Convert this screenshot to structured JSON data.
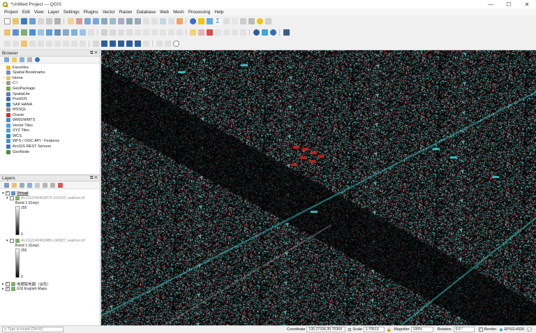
{
  "window": {
    "title": "*Untitled Project — QGIS",
    "minimize": "—",
    "maximize": "☐",
    "close": "✕"
  },
  "menu": [
    "Project",
    "Edit",
    "View",
    "Layer",
    "Settings",
    "Plugins",
    "Vector",
    "Raster",
    "Database",
    "Web",
    "Mesh",
    "Processing",
    "Help"
  ],
  "browser": {
    "title": "Browser",
    "items": [
      {
        "label": "Favorites",
        "icon": "star-icon",
        "color": "#e8b923",
        "twist": ""
      },
      {
        "label": "Spatial Bookmarks",
        "icon": "bookmark-icon",
        "color": "#6d8fb8",
        "twist": ""
      },
      {
        "label": "Home",
        "icon": "home-folder-icon",
        "color": "#e3c36a",
        "twist": "›"
      },
      {
        "label": "C:\\",
        "icon": "drive-icon",
        "color": "#9a9a9a",
        "twist": "›"
      },
      {
        "label": "GeoPackage",
        "icon": "geopackage-icon",
        "color": "#74a84a",
        "twist": ""
      },
      {
        "label": "SpatiaLite",
        "icon": "spatialite-icon",
        "color": "#5a7fbf",
        "twist": ""
      },
      {
        "label": "PostGIS",
        "icon": "postgis-icon",
        "color": "#3b6aa0",
        "twist": ""
      },
      {
        "label": "SAP HANA",
        "icon": "sap-hana-icon",
        "color": "#2a7ab8",
        "twist": ""
      },
      {
        "label": "MSSQL",
        "icon": "mssql-icon",
        "color": "#8a8a8a",
        "twist": ""
      },
      {
        "label": "Oracle",
        "icon": "oracle-icon",
        "color": "#c0392b",
        "twist": ""
      },
      {
        "label": "WMS/WMTS",
        "icon": "wms-globe-icon",
        "color": "#3f8fd0",
        "twist": ""
      },
      {
        "label": "Vector Tiles",
        "icon": "vector-tiles-icon",
        "color": "#5b9bd5",
        "twist": ""
      },
      {
        "label": "XYZ Tiles",
        "icon": "xyz-tiles-icon",
        "color": "#4aa3df",
        "twist": ""
      },
      {
        "label": "WCS",
        "icon": "wcs-icon",
        "color": "#2e86c1",
        "twist": ""
      },
      {
        "label": "WFS / OGC API - Features",
        "icon": "wfs-icon",
        "color": "#4a90c2",
        "twist": ""
      },
      {
        "label": "ArcGIS REST Servers",
        "icon": "arcgis-icon",
        "color": "#3c78b5",
        "twist": ""
      },
      {
        "label": "GeoNode",
        "icon": "geonode-icon",
        "color": "#4d8a3e",
        "twist": ""
      }
    ]
  },
  "layers": {
    "title": "Layers",
    "group_name": "Virtual",
    "raster1": "ALOS2240402870-161010_wallcorr.tif",
    "raster2": "ALOS2240402880-190827_wallcorr.tif",
    "band_label": "Band 1 (Gray)",
    "max_val": "255",
    "min_val": "0",
    "layer_gsi": "地理院地図（淡色）",
    "layer_en": "GSI English Maps"
  },
  "status": {
    "locator_placeholder": "Type to locate (Ctrl+K)",
    "coordinate_label": "Coordinate",
    "coordinate": "135.27336,35.70364",
    "scale_label": "Scale",
    "scale": "1:70513",
    "magnifier_label": "Magnifier",
    "magnifier": "100%",
    "rotation_label": "Rotation",
    "rotation": "0.0 °",
    "render_label": "Render",
    "crs": "EPSG:4326"
  },
  "colors": {
    "panel_bg": "#ffffff",
    "toolbar_bg": "#f0f0f0",
    "map_cyan": "#3fd6d6",
    "map_red": "#e02020"
  }
}
